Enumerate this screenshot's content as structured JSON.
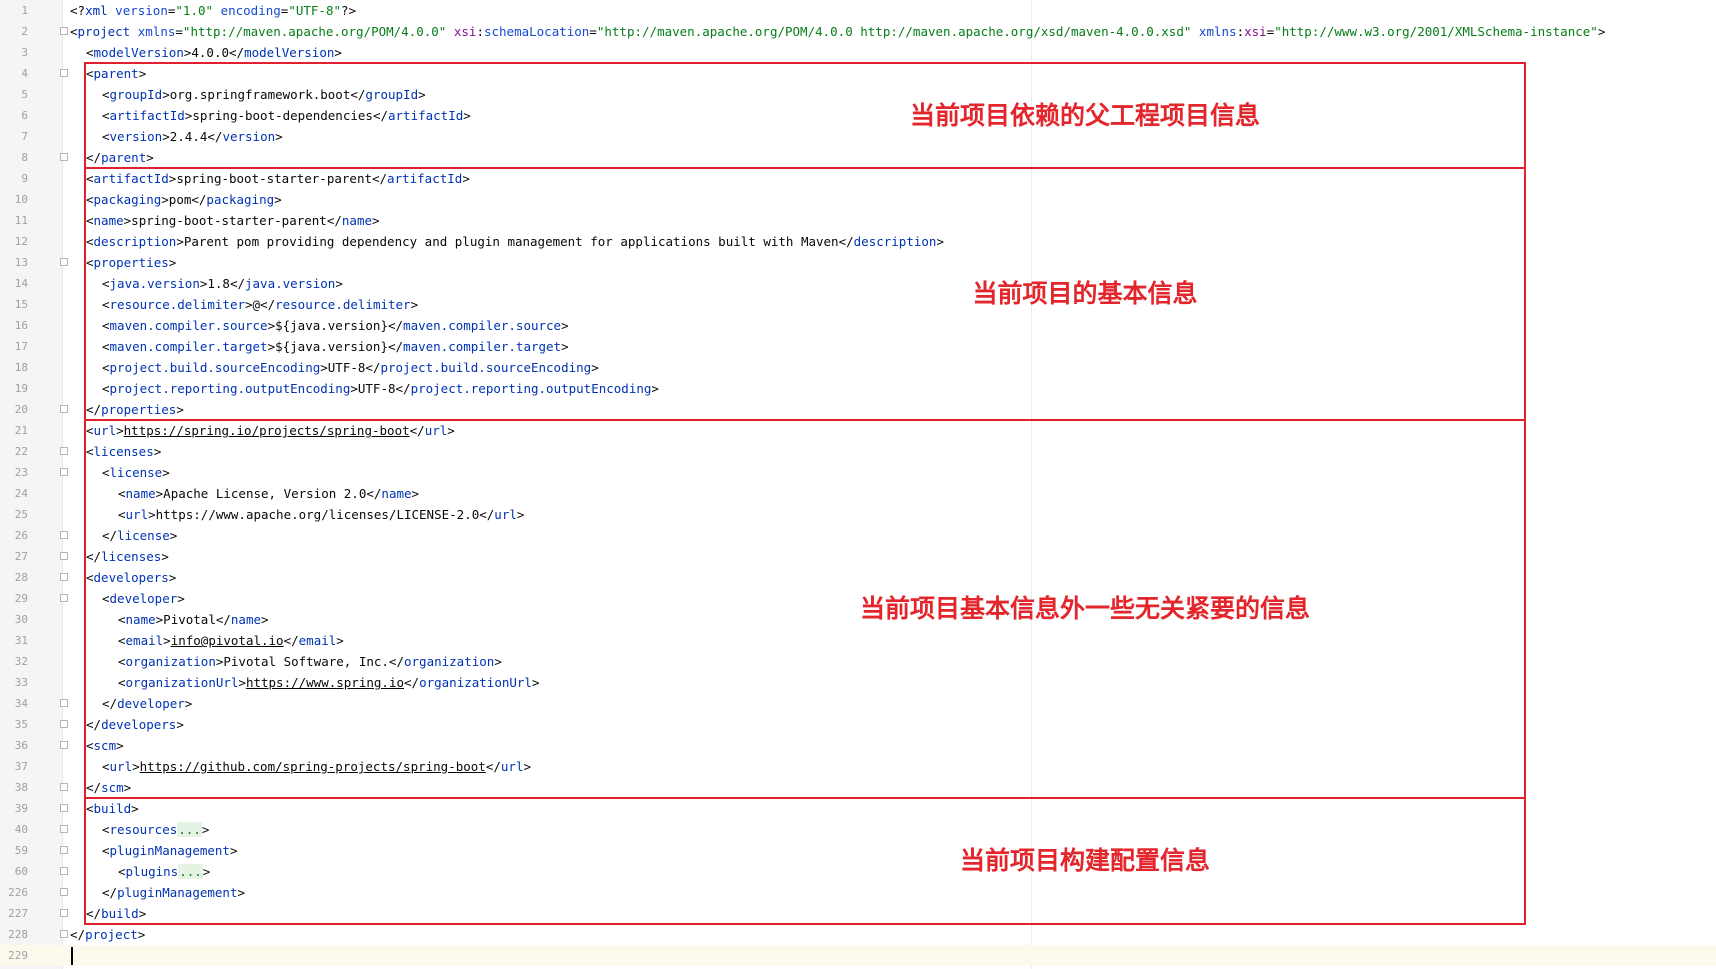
{
  "lines": [
    {
      "n": "1",
      "indent": 0,
      "fold": false,
      "tokens": [
        {
          "t": "p",
          "s": "<?"
        },
        {
          "t": "t",
          "s": "xml"
        },
        {
          "t": "p",
          "s": " "
        },
        {
          "t": "k",
          "s": "version"
        },
        {
          "t": "p",
          "s": "="
        },
        {
          "t": "v",
          "s": "\"1.0\""
        },
        {
          "t": "p",
          "s": " "
        },
        {
          "t": "k",
          "s": "encoding"
        },
        {
          "t": "p",
          "s": "="
        },
        {
          "t": "v",
          "s": "\"UTF-8\""
        },
        {
          "t": "p",
          "s": "?>"
        }
      ]
    },
    {
      "n": "2",
      "indent": 0,
      "fold": true,
      "tokens": [
        {
          "t": "p",
          "s": "<"
        },
        {
          "t": "t",
          "s": "project"
        },
        {
          "t": "p",
          "s": " "
        },
        {
          "t": "k",
          "s": "xmlns"
        },
        {
          "t": "p",
          "s": "="
        },
        {
          "t": "v",
          "s": "\"http://maven.apache.org/POM/4.0.0\""
        },
        {
          "t": "p",
          "s": " "
        },
        {
          "t": "a",
          "s": "xsi"
        },
        {
          "t": "p",
          "s": ":"
        },
        {
          "t": "k",
          "s": "schemaLocation"
        },
        {
          "t": "p",
          "s": "="
        },
        {
          "t": "v",
          "s": "\"http://maven.apache.org/POM/4.0.0 http://maven.apache.org/xsd/maven-4.0.0.xsd\""
        },
        {
          "t": "p",
          "s": " "
        },
        {
          "t": "k",
          "s": "xmlns"
        },
        {
          "t": "p",
          "s": ":"
        },
        {
          "t": "a",
          "s": "xsi"
        },
        {
          "t": "p",
          "s": "="
        },
        {
          "t": "v",
          "s": "\"http://www.w3.org/2001/XMLSchema-instance\""
        },
        {
          "t": "p",
          "s": ">"
        }
      ]
    },
    {
      "n": "3",
      "indent": 1,
      "fold": false,
      "tokens": [
        {
          "t": "p",
          "s": "<"
        },
        {
          "t": "t",
          "s": "modelVersion"
        },
        {
          "t": "p",
          "s": ">4.0.0</"
        },
        {
          "t": "t",
          "s": "modelVersion"
        },
        {
          "t": "p",
          "s": ">"
        }
      ]
    },
    {
      "n": "4",
      "indent": 1,
      "fold": true,
      "tokens": [
        {
          "t": "p",
          "s": "<"
        },
        {
          "t": "t",
          "s": "parent"
        },
        {
          "t": "p",
          "s": ">"
        }
      ]
    },
    {
      "n": "5",
      "indent": 2,
      "fold": false,
      "tokens": [
        {
          "t": "p",
          "s": "<"
        },
        {
          "t": "t",
          "s": "groupId"
        },
        {
          "t": "p",
          "s": ">org.springframework.boot</"
        },
        {
          "t": "t",
          "s": "groupId"
        },
        {
          "t": "p",
          "s": ">"
        }
      ]
    },
    {
      "n": "6",
      "indent": 2,
      "fold": false,
      "tokens": [
        {
          "t": "p",
          "s": "<"
        },
        {
          "t": "t",
          "s": "artifactId"
        },
        {
          "t": "p",
          "s": ">spring-boot-dependencies</"
        },
        {
          "t": "t",
          "s": "artifactId"
        },
        {
          "t": "p",
          "s": ">"
        }
      ]
    },
    {
      "n": "7",
      "indent": 2,
      "fold": false,
      "tokens": [
        {
          "t": "p",
          "s": "<"
        },
        {
          "t": "t",
          "s": "version"
        },
        {
          "t": "p",
          "s": ">2.4.4</"
        },
        {
          "t": "t",
          "s": "version"
        },
        {
          "t": "p",
          "s": ">"
        }
      ]
    },
    {
      "n": "8",
      "indent": 1,
      "fold": true,
      "tokens": [
        {
          "t": "p",
          "s": "</"
        },
        {
          "t": "t",
          "s": "parent"
        },
        {
          "t": "p",
          "s": ">"
        }
      ]
    },
    {
      "n": "9",
      "indent": 1,
      "fold": false,
      "tokens": [
        {
          "t": "p",
          "s": "<"
        },
        {
          "t": "t",
          "s": "artifactId"
        },
        {
          "t": "p",
          "s": ">spring-boot-starter-parent</"
        },
        {
          "t": "t",
          "s": "artifactId"
        },
        {
          "t": "p",
          "s": ">"
        }
      ]
    },
    {
      "n": "10",
      "indent": 1,
      "fold": false,
      "tokens": [
        {
          "t": "p",
          "s": "<"
        },
        {
          "t": "t",
          "s": "packaging"
        },
        {
          "t": "p",
          "s": ">pom</"
        },
        {
          "t": "t",
          "s": "packaging"
        },
        {
          "t": "p",
          "s": ">"
        }
      ]
    },
    {
      "n": "11",
      "indent": 1,
      "fold": false,
      "tokens": [
        {
          "t": "p",
          "s": "<"
        },
        {
          "t": "t",
          "s": "name"
        },
        {
          "t": "p",
          "s": ">spring-boot-starter-parent</"
        },
        {
          "t": "t",
          "s": "name"
        },
        {
          "t": "p",
          "s": ">"
        }
      ]
    },
    {
      "n": "12",
      "indent": 1,
      "fold": false,
      "tokens": [
        {
          "t": "p",
          "s": "<"
        },
        {
          "t": "t",
          "s": "description"
        },
        {
          "t": "p",
          "s": ">Parent pom providing dependency and plugin management for applications built with Maven</"
        },
        {
          "t": "t",
          "s": "description"
        },
        {
          "t": "p",
          "s": ">"
        }
      ]
    },
    {
      "n": "13",
      "indent": 1,
      "fold": true,
      "tokens": [
        {
          "t": "p",
          "s": "<"
        },
        {
          "t": "t",
          "s": "properties"
        },
        {
          "t": "p",
          "s": ">"
        }
      ]
    },
    {
      "n": "14",
      "indent": 2,
      "fold": false,
      "tokens": [
        {
          "t": "p",
          "s": "<"
        },
        {
          "t": "t",
          "s": "java.version"
        },
        {
          "t": "p",
          "s": ">1.8</"
        },
        {
          "t": "t",
          "s": "java.version"
        },
        {
          "t": "p",
          "s": ">"
        }
      ]
    },
    {
      "n": "15",
      "indent": 2,
      "fold": false,
      "tokens": [
        {
          "t": "p",
          "s": "<"
        },
        {
          "t": "t",
          "s": "resource.delimiter"
        },
        {
          "t": "p",
          "s": ">@</"
        },
        {
          "t": "t",
          "s": "resource.delimiter"
        },
        {
          "t": "p",
          "s": ">"
        }
      ]
    },
    {
      "n": "16",
      "indent": 2,
      "fold": false,
      "tokens": [
        {
          "t": "p",
          "s": "<"
        },
        {
          "t": "t",
          "s": "maven.compiler.source"
        },
        {
          "t": "p",
          "s": ">${java.version}</"
        },
        {
          "t": "t",
          "s": "maven.compiler.source"
        },
        {
          "t": "p",
          "s": ">"
        }
      ]
    },
    {
      "n": "17",
      "indent": 2,
      "fold": false,
      "tokens": [
        {
          "t": "p",
          "s": "<"
        },
        {
          "t": "t",
          "s": "maven.compiler.target"
        },
        {
          "t": "p",
          "s": ">${java.version}</"
        },
        {
          "t": "t",
          "s": "maven.compiler.target"
        },
        {
          "t": "p",
          "s": ">"
        }
      ]
    },
    {
      "n": "18",
      "indent": 2,
      "fold": false,
      "tokens": [
        {
          "t": "p",
          "s": "<"
        },
        {
          "t": "t",
          "s": "project.build.sourceEncoding"
        },
        {
          "t": "p",
          "s": ">UTF-8</"
        },
        {
          "t": "t",
          "s": "project.build.sourceEncoding"
        },
        {
          "t": "p",
          "s": ">"
        }
      ]
    },
    {
      "n": "19",
      "indent": 2,
      "fold": false,
      "tokens": [
        {
          "t": "p",
          "s": "<"
        },
        {
          "t": "t",
          "s": "project.reporting.outputEncoding"
        },
        {
          "t": "p",
          "s": ">UTF-8</"
        },
        {
          "t": "t",
          "s": "project.reporting.outputEncoding"
        },
        {
          "t": "p",
          "s": ">"
        }
      ]
    },
    {
      "n": "20",
      "indent": 1,
      "fold": true,
      "tokens": [
        {
          "t": "p",
          "s": "</"
        },
        {
          "t": "t",
          "s": "properties"
        },
        {
          "t": "p",
          "s": ">"
        }
      ]
    },
    {
      "n": "21",
      "indent": 1,
      "fold": false,
      "tokens": [
        {
          "t": "p",
          "s": "<"
        },
        {
          "t": "t",
          "s": "url"
        },
        {
          "t": "p",
          "s": ">"
        },
        {
          "t": "u",
          "s": "https://spring.io/projects/spring-boot"
        },
        {
          "t": "p",
          "s": "</"
        },
        {
          "t": "t",
          "s": "url"
        },
        {
          "t": "p",
          "s": ">"
        }
      ]
    },
    {
      "n": "22",
      "indent": 1,
      "fold": true,
      "tokens": [
        {
          "t": "p",
          "s": "<"
        },
        {
          "t": "t",
          "s": "licenses"
        },
        {
          "t": "p",
          "s": ">"
        }
      ]
    },
    {
      "n": "23",
      "indent": 2,
      "fold": true,
      "tokens": [
        {
          "t": "p",
          "s": "<"
        },
        {
          "t": "t",
          "s": "license"
        },
        {
          "t": "p",
          "s": ">"
        }
      ]
    },
    {
      "n": "24",
      "indent": 3,
      "fold": false,
      "tokens": [
        {
          "t": "p",
          "s": "<"
        },
        {
          "t": "t",
          "s": "name"
        },
        {
          "t": "p",
          "s": ">Apache License, Version 2.0</"
        },
        {
          "t": "t",
          "s": "name"
        },
        {
          "t": "p",
          "s": ">"
        }
      ]
    },
    {
      "n": "25",
      "indent": 3,
      "fold": false,
      "tokens": [
        {
          "t": "p",
          "s": "<"
        },
        {
          "t": "t",
          "s": "url"
        },
        {
          "t": "p",
          "s": ">https://www.apache.org/licenses/LICENSE-2.0</"
        },
        {
          "t": "t",
          "s": "url"
        },
        {
          "t": "p",
          "s": ">"
        }
      ]
    },
    {
      "n": "26",
      "indent": 2,
      "fold": true,
      "tokens": [
        {
          "t": "p",
          "s": "</"
        },
        {
          "t": "t",
          "s": "license"
        },
        {
          "t": "p",
          "s": ">"
        }
      ]
    },
    {
      "n": "27",
      "indent": 1,
      "fold": true,
      "tokens": [
        {
          "t": "p",
          "s": "</"
        },
        {
          "t": "t",
          "s": "licenses"
        },
        {
          "t": "p",
          "s": ">"
        }
      ]
    },
    {
      "n": "28",
      "indent": 1,
      "fold": true,
      "tokens": [
        {
          "t": "p",
          "s": "<"
        },
        {
          "t": "t",
          "s": "developers"
        },
        {
          "t": "p",
          "s": ">"
        }
      ]
    },
    {
      "n": "29",
      "indent": 2,
      "fold": true,
      "tokens": [
        {
          "t": "p",
          "s": "<"
        },
        {
          "t": "t",
          "s": "developer"
        },
        {
          "t": "p",
          "s": ">"
        }
      ]
    },
    {
      "n": "30",
      "indent": 3,
      "fold": false,
      "tokens": [
        {
          "t": "p",
          "s": "<"
        },
        {
          "t": "t",
          "s": "name"
        },
        {
          "t": "p",
          "s": ">Pivotal</"
        },
        {
          "t": "t",
          "s": "name"
        },
        {
          "t": "p",
          "s": ">"
        }
      ]
    },
    {
      "n": "31",
      "indent": 3,
      "fold": false,
      "tokens": [
        {
          "t": "p",
          "s": "<"
        },
        {
          "t": "t",
          "s": "email"
        },
        {
          "t": "p",
          "s": ">"
        },
        {
          "t": "u",
          "s": "info@pivotal.io"
        },
        {
          "t": "p",
          "s": "</"
        },
        {
          "t": "t",
          "s": "email"
        },
        {
          "t": "p",
          "s": ">"
        }
      ]
    },
    {
      "n": "32",
      "indent": 3,
      "fold": false,
      "tokens": [
        {
          "t": "p",
          "s": "<"
        },
        {
          "t": "t",
          "s": "organization"
        },
        {
          "t": "p",
          "s": ">Pivotal Software, Inc.</"
        },
        {
          "t": "t",
          "s": "organization"
        },
        {
          "t": "p",
          "s": ">"
        }
      ]
    },
    {
      "n": "33",
      "indent": 3,
      "fold": false,
      "tokens": [
        {
          "t": "p",
          "s": "<"
        },
        {
          "t": "t",
          "s": "organizationUrl"
        },
        {
          "t": "p",
          "s": ">"
        },
        {
          "t": "u",
          "s": "https://www.spring.io"
        },
        {
          "t": "p",
          "s": "</"
        },
        {
          "t": "t",
          "s": "organizationUrl"
        },
        {
          "t": "p",
          "s": ">"
        }
      ]
    },
    {
      "n": "34",
      "indent": 2,
      "fold": true,
      "tokens": [
        {
          "t": "p",
          "s": "</"
        },
        {
          "t": "t",
          "s": "developer"
        },
        {
          "t": "p",
          "s": ">"
        }
      ]
    },
    {
      "n": "35",
      "indent": 1,
      "fold": true,
      "tokens": [
        {
          "t": "p",
          "s": "</"
        },
        {
          "t": "t",
          "s": "developers"
        },
        {
          "t": "p",
          "s": ">"
        }
      ]
    },
    {
      "n": "36",
      "indent": 1,
      "fold": true,
      "tokens": [
        {
          "t": "p",
          "s": "<"
        },
        {
          "t": "t",
          "s": "scm"
        },
        {
          "t": "p",
          "s": ">"
        }
      ]
    },
    {
      "n": "37",
      "indent": 2,
      "fold": false,
      "tokens": [
        {
          "t": "p",
          "s": "<"
        },
        {
          "t": "t",
          "s": "url"
        },
        {
          "t": "p",
          "s": ">"
        },
        {
          "t": "u",
          "s": "https://github.com/spring-projects/spring-boot"
        },
        {
          "t": "p",
          "s": "</"
        },
        {
          "t": "t",
          "s": "url"
        },
        {
          "t": "p",
          "s": ">"
        }
      ]
    },
    {
      "n": "38",
      "indent": 1,
      "fold": true,
      "tokens": [
        {
          "t": "p",
          "s": "</"
        },
        {
          "t": "t",
          "s": "scm"
        },
        {
          "t": "p",
          "s": ">"
        }
      ]
    },
    {
      "n": "39",
      "indent": 1,
      "fold": true,
      "tokens": [
        {
          "t": "p",
          "s": "<"
        },
        {
          "t": "t",
          "s": "build"
        },
        {
          "t": "p",
          "s": ">"
        }
      ]
    },
    {
      "n": "40",
      "indent": 2,
      "fold": true,
      "tokens": [
        {
          "t": "p",
          "s": "<"
        },
        {
          "t": "t",
          "s": "resources"
        },
        {
          "t": "fd",
          "s": "..."
        },
        {
          "t": "p",
          "s": ">"
        }
      ]
    },
    {
      "n": "59",
      "indent": 2,
      "fold": true,
      "tokens": [
        {
          "t": "p",
          "s": "<"
        },
        {
          "t": "t",
          "s": "pluginManagement"
        },
        {
          "t": "p",
          "s": ">"
        }
      ]
    },
    {
      "n": "60",
      "indent": 3,
      "fold": true,
      "tokens": [
        {
          "t": "p",
          "s": "<"
        },
        {
          "t": "t",
          "s": "plugins"
        },
        {
          "t": "fd",
          "s": "..."
        },
        {
          "t": "p",
          "s": ">"
        }
      ]
    },
    {
      "n": "226",
      "indent": 2,
      "fold": true,
      "tokens": [
        {
          "t": "p",
          "s": "</"
        },
        {
          "t": "t",
          "s": "pluginManagement"
        },
        {
          "t": "p",
          "s": ">"
        }
      ]
    },
    {
      "n": "227",
      "indent": 1,
      "fold": true,
      "tokens": [
        {
          "t": "p",
          "s": "</"
        },
        {
          "t": "t",
          "s": "build"
        },
        {
          "t": "p",
          "s": ">"
        }
      ]
    },
    {
      "n": "228",
      "indent": 0,
      "fold": true,
      "tokens": [
        {
          "t": "p",
          "s": "</"
        },
        {
          "t": "t",
          "s": "project"
        },
        {
          "t": "p",
          "s": ">"
        }
      ]
    },
    {
      "n": "229",
      "indent": 0,
      "fold": false,
      "current": true,
      "tokens": []
    }
  ],
  "annotations": [
    {
      "label": "当前项目依赖的父工程项目信息",
      "from": 4,
      "to": 8
    },
    {
      "label": "当前项目的基本信息",
      "from": 9,
      "to": 20
    },
    {
      "label": "当前项目基本信息外一些无关紧要的信息",
      "from": 21,
      "to": 38
    },
    {
      "label": "当前项目构建配置信息",
      "from": 39,
      "to": 227
    }
  ],
  "colors": {
    "tag": "#0033b3",
    "attr": "#174ad4",
    "namespace": "#871094",
    "value": "#067d17",
    "annotation": "#e3262c"
  }
}
